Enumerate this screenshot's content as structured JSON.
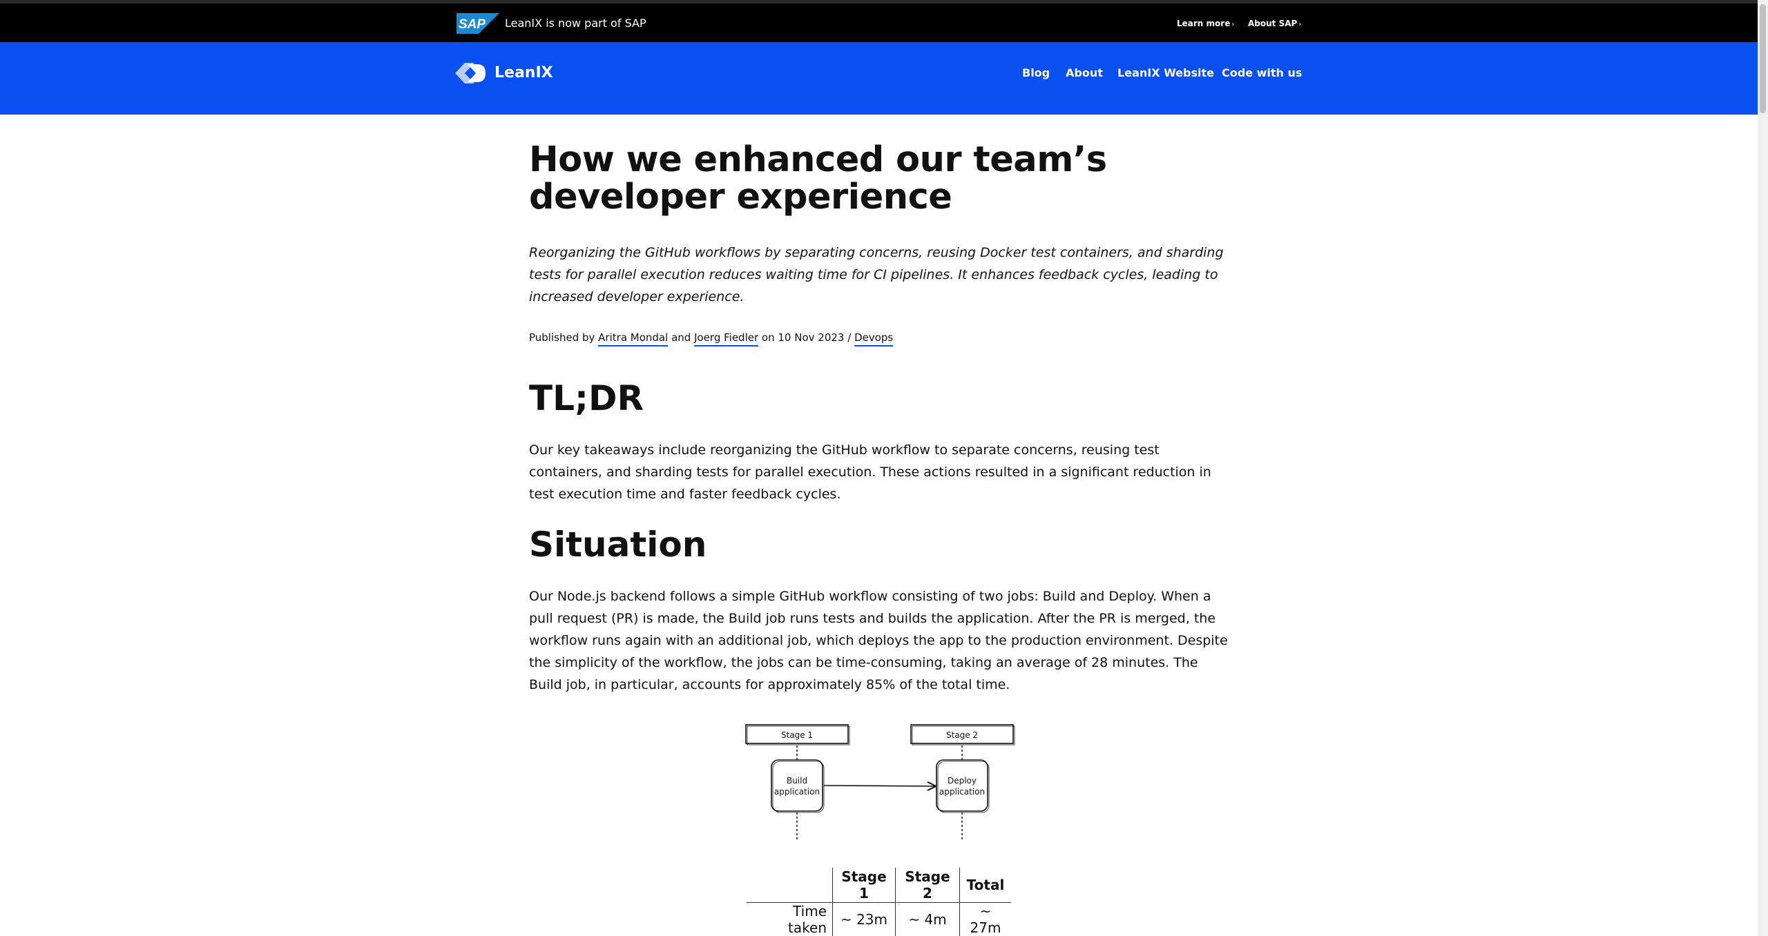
{
  "sap_banner": {
    "logo_text": "SAP",
    "text": "LeanIX is now part of SAP",
    "links": [
      {
        "label": "Learn more",
        "chevron": "›"
      },
      {
        "label": "About SAP",
        "chevron": "›"
      }
    ]
  },
  "header": {
    "brand": "LeanIX",
    "nav": [
      "Blog",
      "About",
      "LeanIX Website",
      "Code with us"
    ]
  },
  "colors": {
    "brand_blue": "#0a4ff0",
    "sap_blue": "#1a8ad2",
    "banner_black": "#000000"
  },
  "article": {
    "title": "How we enhanced our team’s developer experience",
    "lead": "Reorganizing the GitHub workflows by separating concerns, reusing Docker test containers, and sharding tests for parallel execution reduces waiting time for CI pipelines. It enhances feedback cycles, leading to increased developer experience.",
    "meta": {
      "published_by": "Published by",
      "author1": "Aritra Mondal",
      "and": "and",
      "author2": "Joerg Fiedler",
      "on_date": "on 10 Nov 2023 /",
      "category": "Devops"
    },
    "sections": [
      {
        "heading": "TL;DR",
        "text": "Our key takeaways include reorganizing the GitHub workflow to separate concerns, reusing test containers, and sharding tests for parallel execution. These actions resulted in a significant reduction in test execution time and faster feedback cycles."
      },
      {
        "heading": "Situation",
        "text": "Our Node.js backend follows a simple GitHub workflow consisting of two jobs: Build and Deploy. When a pull request (PR) is made, the Build job runs tests and builds the application. After the PR is merged, the workflow runs again with an additional job, which deploys the app to the production environment. Despite the simplicity of the workflow, the jobs can be time-consuming, taking an average of 28 minutes. The Build job, in particular, accounts for approximately 85% of the total time."
      }
    ],
    "diagram": {
      "stage1": "Stage 1",
      "stage2": "Stage 2",
      "box1": [
        "Build",
        "application"
      ],
      "box2": [
        "Deploy",
        "application"
      ]
    },
    "table": {
      "headers": [
        "",
        "Stage 1",
        "Stage 2",
        "Total"
      ],
      "rows": [
        [
          "Time taken",
          "~ 23m",
          "~ 4m",
          "~ 27m"
        ]
      ]
    }
  }
}
